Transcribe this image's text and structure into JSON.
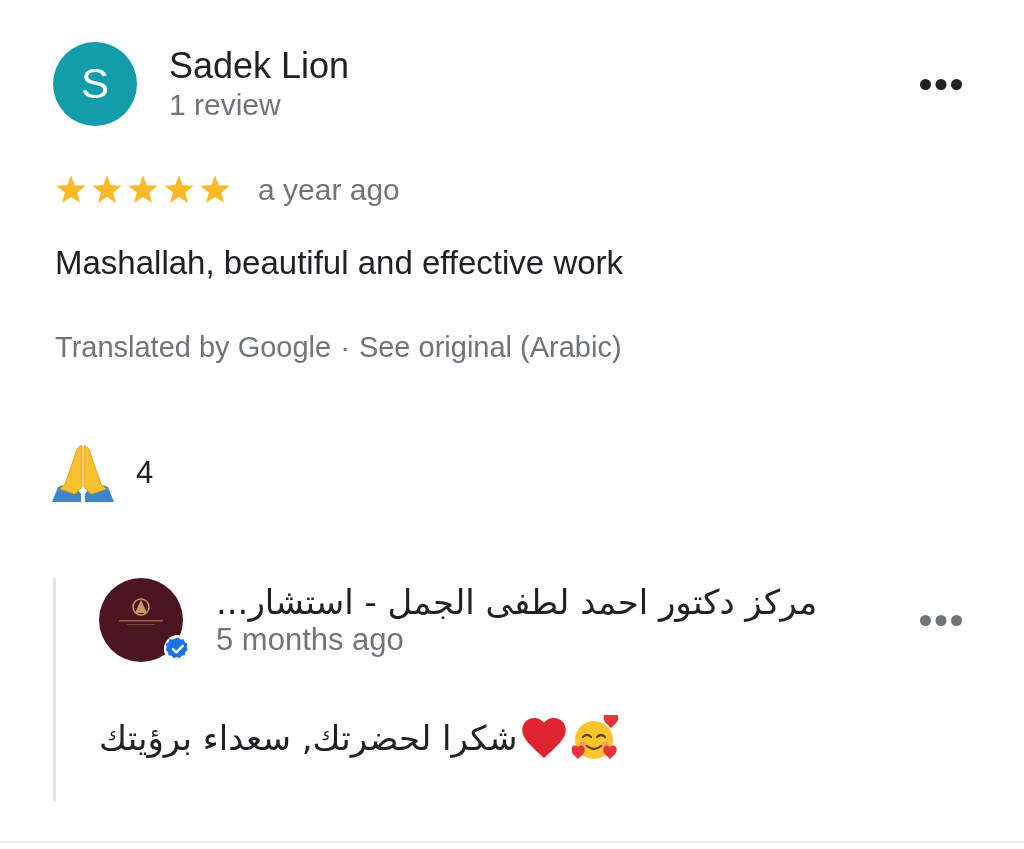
{
  "review": {
    "author": {
      "initial": "S",
      "name": "Sadek Lion",
      "meta": "1 review"
    },
    "stars": 5,
    "time": "a year ago",
    "text": "Mashallah, beautiful and effective work",
    "translation": {
      "note": "Translated by Google",
      "separator": "·",
      "link": "See original (Arabic)"
    },
    "reactions": [
      {
        "count": "4"
      }
    ]
  },
  "owner_reply": {
    "name": "مركز دكتور احمد لطفى الجمل - استشار...",
    "verified": true,
    "time": "5 months ago",
    "text": "شكرا لحضرتك, سعداء برؤيتك"
  }
}
